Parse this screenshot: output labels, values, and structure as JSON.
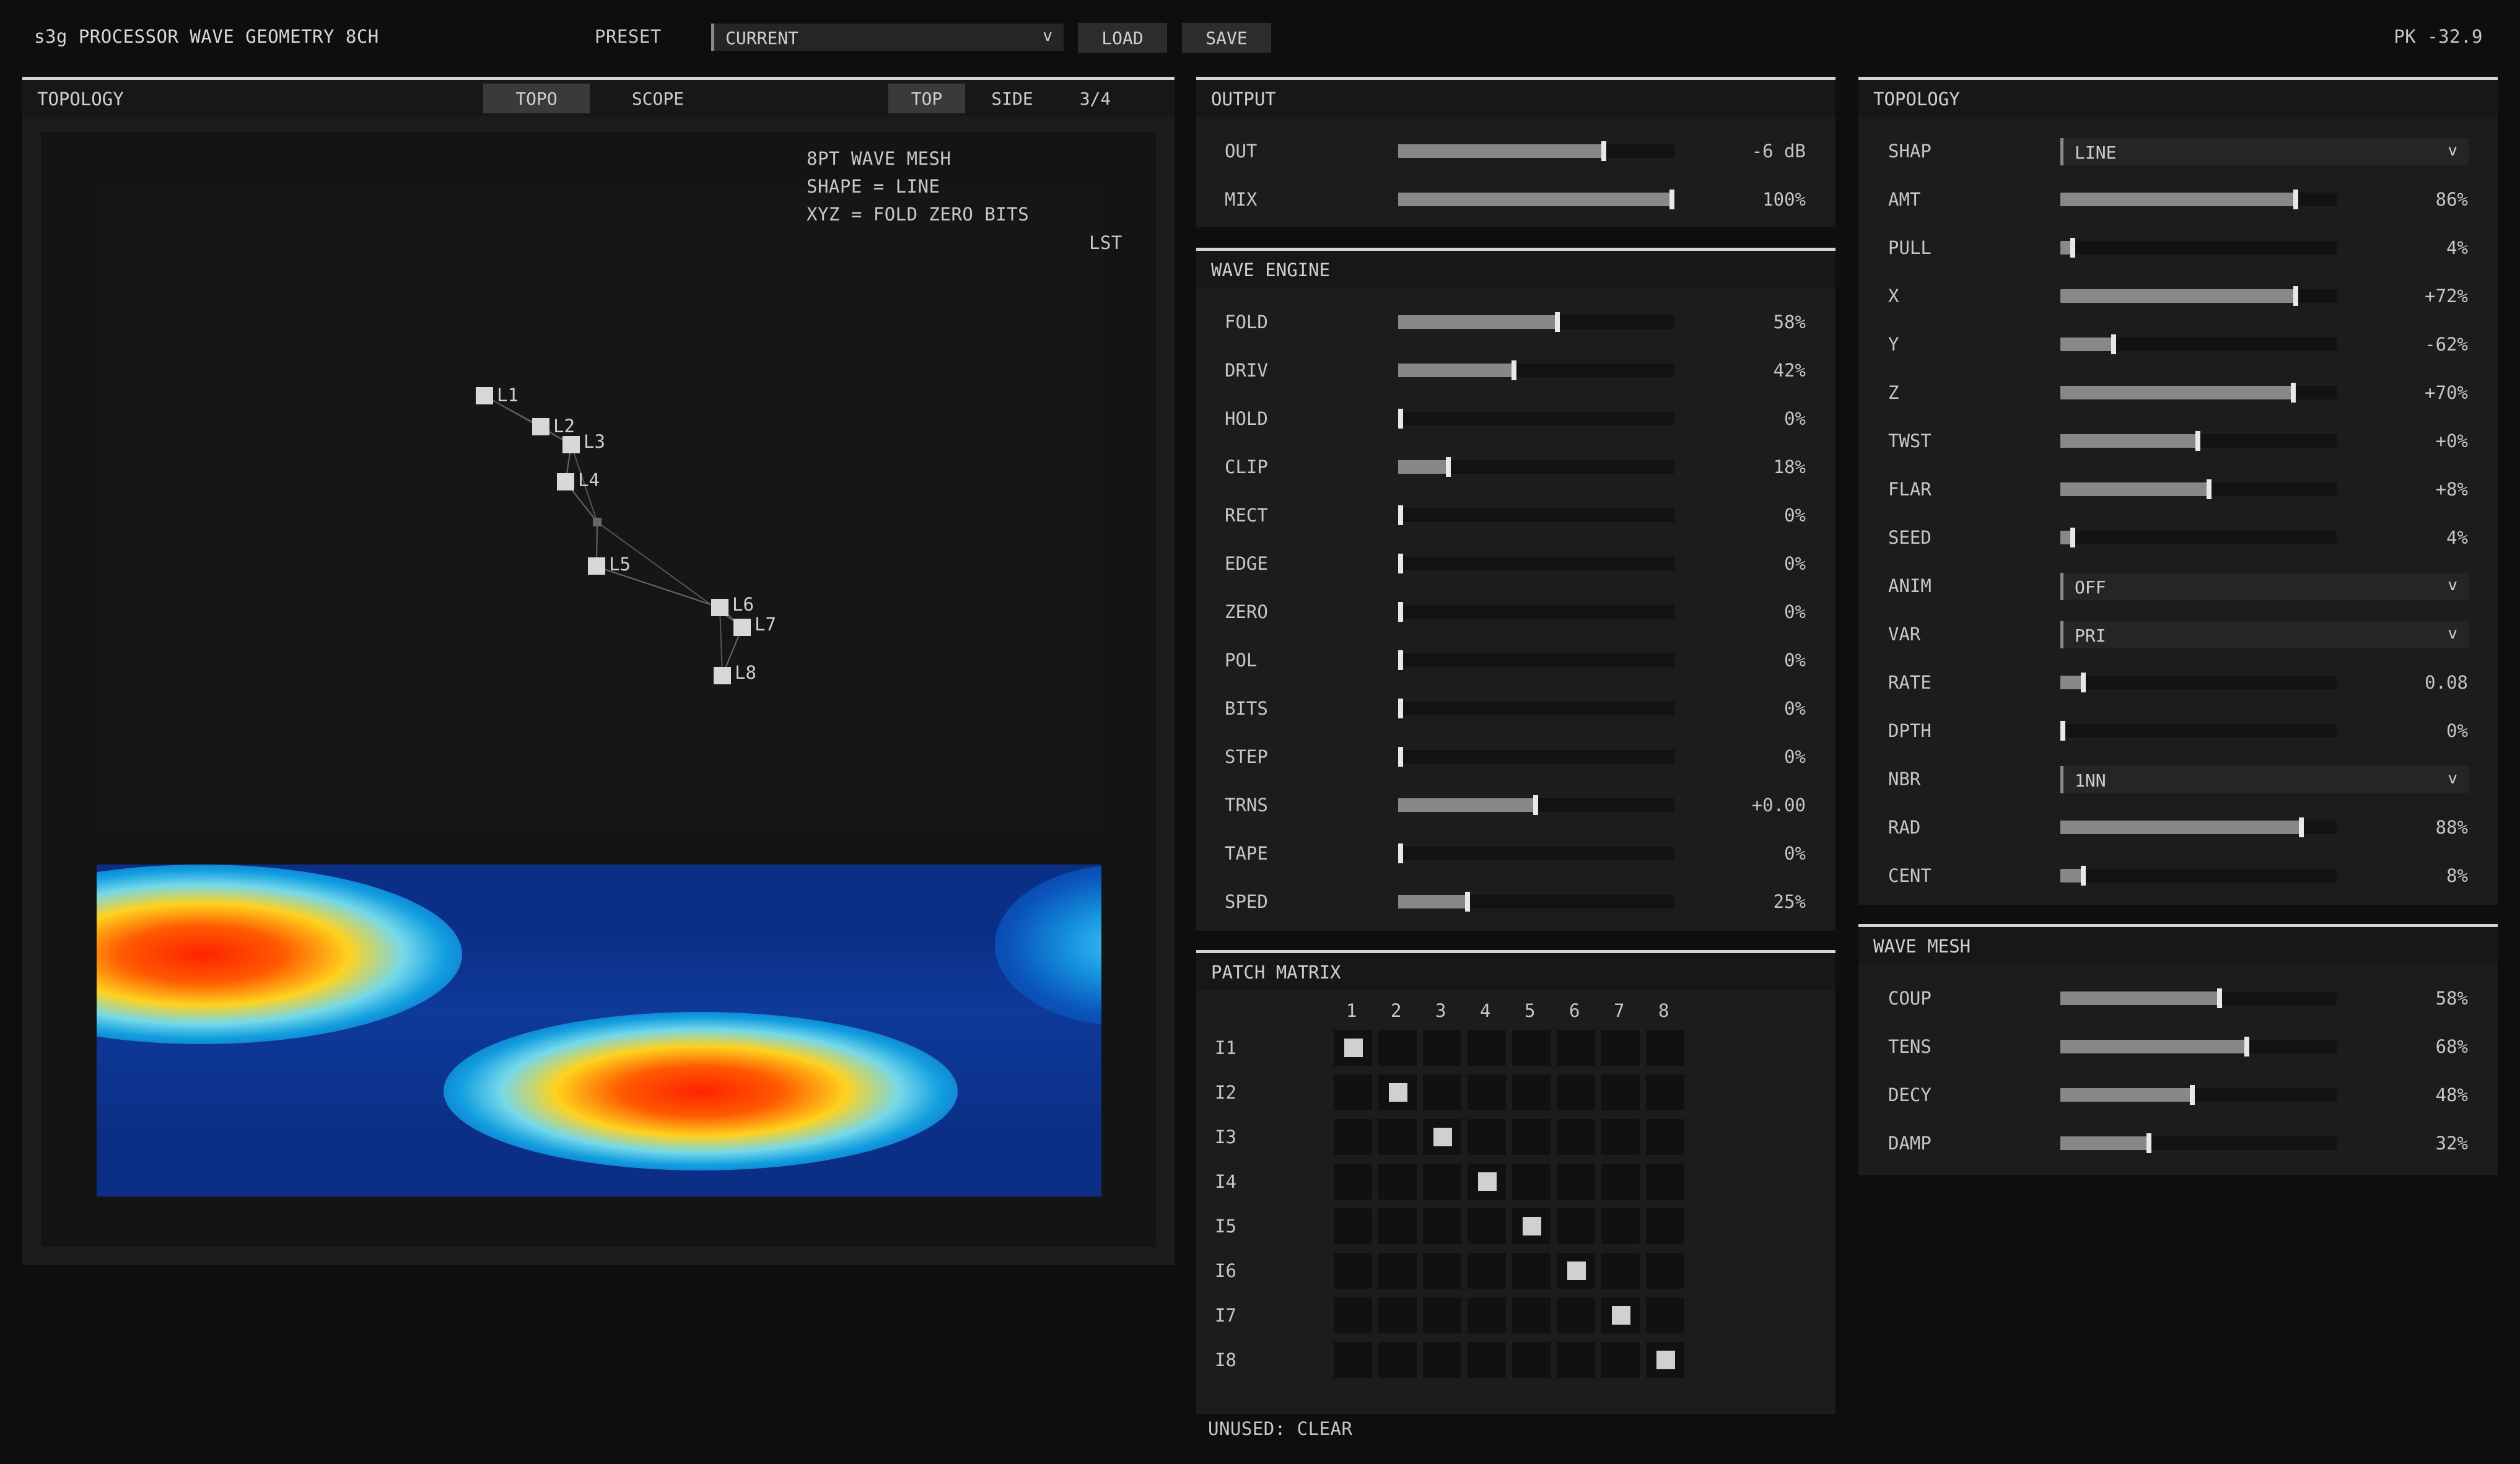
{
  "header": {
    "title": "s3g PROCESSOR WAVE GEOMETRY 8CH",
    "preset_label": "PRESET",
    "preset_value": "CURRENT",
    "load_label": "LOAD",
    "save_label": "SAVE",
    "peak": "PK -32.9"
  },
  "topo_panel": {
    "title": "TOPOLOGY",
    "tabs": [
      "TOPO",
      "SCOPE"
    ],
    "views": [
      "TOP",
      "SIDE",
      "3/4"
    ],
    "info_lines": [
      "8PT WAVE MESH",
      "SHAPE = LINE",
      "XYZ = FOLD ZERO BITS"
    ],
    "lst_label": "LST",
    "nodes": [
      "L1",
      "L2",
      "L3",
      "L4",
      "L5",
      "L6",
      "L7",
      "L8"
    ]
  },
  "output": {
    "title": "OUTPUT",
    "rows": [
      {
        "label": "OUT",
        "value": "-6 dB",
        "level": 0.75
      },
      {
        "label": "MIX",
        "value": "100%",
        "level": 1.0
      }
    ]
  },
  "wave_engine": {
    "title": "WAVE ENGINE",
    "rows": [
      {
        "label": "FOLD",
        "value": "58%",
        "level": 0.58
      },
      {
        "label": "DRIV",
        "value": "42%",
        "level": 0.42
      },
      {
        "label": "HOLD",
        "value": "0%",
        "level": 0
      },
      {
        "label": "CLIP",
        "value": "18%",
        "level": 0.18
      },
      {
        "label": "RECT",
        "value": "0%",
        "level": 0
      },
      {
        "label": "EDGE",
        "value": "0%",
        "level": 0
      },
      {
        "label": "ZERO",
        "value": "0%",
        "level": 0
      },
      {
        "label": "POL",
        "value": "0%",
        "level": 0
      },
      {
        "label": "BITS",
        "value": "0%",
        "level": 0
      },
      {
        "label": "STEP",
        "value": "0%",
        "level": 0
      },
      {
        "label": "TRNS",
        "value": "+0.00",
        "level": 0.5
      },
      {
        "label": "TAPE",
        "value": "0%",
        "level": 0
      },
      {
        "label": "SPED",
        "value": "25%",
        "level": 0.25
      }
    ]
  },
  "patch": {
    "title": "PATCH MATRIX",
    "cols": [
      "1",
      "2",
      "3",
      "4",
      "5",
      "6",
      "7",
      "8"
    ],
    "rows": [
      "I1",
      "I2",
      "I3",
      "I4",
      "I5",
      "I6",
      "I7",
      "I8"
    ],
    "footer": "UNUSED: CLEAR"
  },
  "topology": {
    "title": "TOPOLOGY",
    "rows": [
      {
        "label": "SHAP",
        "kind": "select",
        "value": "LINE"
      },
      {
        "label": "AMT",
        "kind": "slider",
        "value": "86%",
        "level": 0.86
      },
      {
        "label": "PULL",
        "kind": "slider",
        "value": "4%",
        "level": 0.04
      },
      {
        "label": "X",
        "kind": "slider",
        "value": "+72%",
        "level": 0.86
      },
      {
        "label": "Y",
        "kind": "slider",
        "value": "-62%",
        "level": 0.19
      },
      {
        "label": "Z",
        "kind": "slider",
        "value": "+70%",
        "level": 0.85
      },
      {
        "label": "TWST",
        "kind": "slider",
        "value": "+0%",
        "level": 0.5
      },
      {
        "label": "FLAR",
        "kind": "slider",
        "value": "+8%",
        "level": 0.54
      },
      {
        "label": "SEED",
        "kind": "slider",
        "value": "4%",
        "level": 0.04
      },
      {
        "label": "ANIM",
        "kind": "select",
        "value": "OFF"
      },
      {
        "label": "VAR",
        "kind": "select",
        "value": "PRI"
      },
      {
        "label": "RATE",
        "kind": "slider",
        "value": "0.08",
        "level": 0.08
      },
      {
        "label": "DPTH",
        "kind": "slider",
        "value": "0%",
        "level": 0
      },
      {
        "label": "NBR",
        "kind": "select",
        "value": "1NN"
      },
      {
        "label": "RAD",
        "kind": "slider",
        "value": "88%",
        "level": 0.88
      },
      {
        "label": "CENT",
        "kind": "slider",
        "value": "8%",
        "level": 0.08
      }
    ]
  },
  "wave_mesh": {
    "title": "WAVE MESH",
    "rows": [
      {
        "label": "COUP",
        "value": "58%",
        "level": 0.58
      },
      {
        "label": "TENS",
        "value": "68%",
        "level": 0.68
      },
      {
        "label": "DECY",
        "value": "48%",
        "level": 0.48
      },
      {
        "label": "DAMP",
        "value": "32%",
        "level": 0.32
      }
    ]
  },
  "icons": {
    "chevron": "chevron-down-icon"
  },
  "colors": {
    "accent": "#d4d4d4",
    "panel": "#1c1c1c",
    "background": "#0e0e0e"
  }
}
